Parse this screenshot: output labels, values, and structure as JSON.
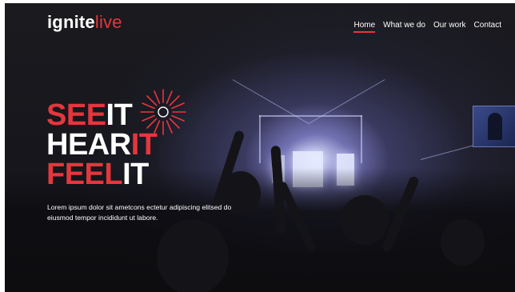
{
  "brand": {
    "name_part1": "ignite",
    "name_part2": "live"
  },
  "nav": {
    "items": [
      {
        "label": "Home",
        "active": true
      },
      {
        "label": "What we do",
        "active": false
      },
      {
        "label": "Our work",
        "active": false
      },
      {
        "label": "Contact",
        "active": false
      }
    ]
  },
  "hero": {
    "line1_red": "SEE",
    "line1_white": "IT",
    "line2_white": "HEAR",
    "line2_red": "IT",
    "line3_red": "FEEL",
    "line3_white": "IT",
    "tagline": "Lorem ipsum dolor sit ametcons ectetur adipiscing elitsed do eiusmod tempor incididunt ut labore."
  },
  "colors": {
    "accent": "#e6363d",
    "text": "#ffffff",
    "background": "#16161c"
  },
  "icons": {
    "burst": "sunburst-icon"
  }
}
